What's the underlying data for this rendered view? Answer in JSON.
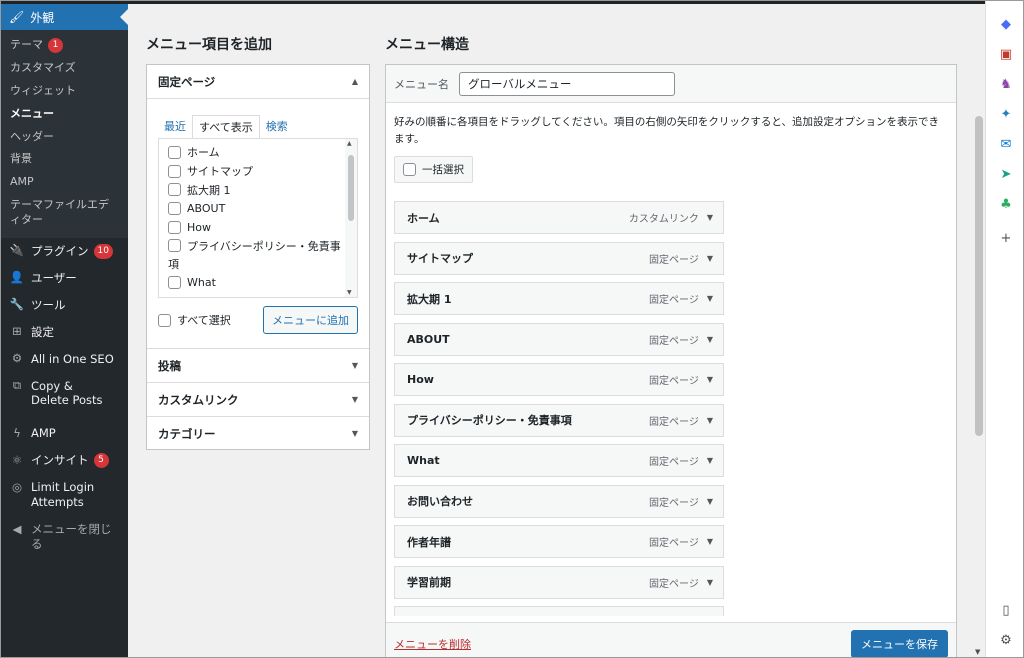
{
  "sidebar": {
    "appearance": "外観",
    "submenu": [
      {
        "label": "テーマ",
        "badge": "1"
      },
      {
        "label": "カスタマイズ"
      },
      {
        "label": "ウィジェット"
      },
      {
        "label": "メニュー"
      },
      {
        "label": "ヘッダー"
      },
      {
        "label": "背景"
      },
      {
        "label": "AMP"
      },
      {
        "label": "テーマファイルエディター"
      }
    ],
    "items": [
      {
        "label": "プラグイン",
        "badge": "10"
      },
      {
        "label": "ユーザー"
      },
      {
        "label": "ツール"
      },
      {
        "label": "設定"
      },
      {
        "label": "All in One SEO"
      },
      {
        "label": "Copy & Delete Posts"
      },
      {
        "label": "AMP"
      },
      {
        "label": "インサイト",
        "badge": "5"
      },
      {
        "label": "Limit Login Attempts"
      },
      {
        "label": "メニューを閉じる"
      }
    ]
  },
  "left": {
    "title": "メニュー項目を追加",
    "pages_header": "固定ページ",
    "tabs": [
      "最近",
      "すべて表示",
      "検索"
    ],
    "pages": [
      "ホーム",
      "サイトマップ",
      "拡大期 1",
      "ABOUT",
      "How",
      "プライバシーポリシー・免責事",
      "項",
      "What"
    ],
    "select_all": "すべて選択",
    "add_button": "メニューに追加",
    "sections": [
      "投稿",
      "カスタムリンク",
      "カテゴリー"
    ]
  },
  "right": {
    "title": "メニュー構造",
    "menu_name_label": "メニュー名",
    "menu_name_value": "グローバルメニュー",
    "help_text": "好みの順番に各項目をドラッグしてください。項目の右側の矢印をクリックすると、追加設定オプションを表示できます。",
    "bulk_select": "一括選択",
    "items": [
      {
        "label": "ホーム",
        "type": "カスタムリンク"
      },
      {
        "label": "サイトマップ",
        "type": "固定ページ"
      },
      {
        "label": "拡大期 1",
        "type": "固定ページ"
      },
      {
        "label": "ABOUT",
        "type": "固定ページ"
      },
      {
        "label": "How",
        "type": "固定ページ"
      },
      {
        "label": "プライバシーポリシー・免責事項",
        "type": "固定ページ"
      },
      {
        "label": "What",
        "type": "固定ページ"
      },
      {
        "label": "お問い合わせ",
        "type": "固定ページ"
      },
      {
        "label": "作者年譜",
        "type": "固定ページ"
      },
      {
        "label": "学習前期",
        "type": "固定ページ"
      }
    ],
    "delete_link": "メニューを削除",
    "save_button": "メニューを保存"
  },
  "colors": {
    "accent": "#2271b1",
    "sidebar": "#23282d",
    "badge": "#d63638",
    "delete": "#b32d2e"
  }
}
